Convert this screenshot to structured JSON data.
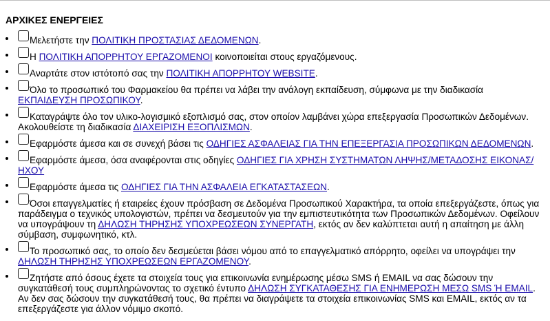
{
  "heading": "ΑΡΧΙΚΕΣ ΕΝΕΡΓΕΙΕΣ",
  "items": [
    {
      "pre": "Μελετήστε την ",
      "link": "ΠΟΛΙΤΙΚΗ ΠΡΟΣΤΑΣΙΑΣ ΔΕΔΟΜΕΝΩΝ",
      "post": "."
    },
    {
      "pre": "Η ",
      "link": "ΠΟΛΙΤΙΚΗ ΑΠΟΡΡΗΤΟΥ ΕΡΓΑΖΟΜΕΝΟΙ",
      "post": " κοινοποιείται στους εργαζόμενους."
    },
    {
      "pre": "Αναρτάτε στον ιστότοπό σας την ",
      "link": "ΠΟΛΙΤΙΚΗ ΑΠΟΡΡΗΤΟΥ WEBSITE",
      "post": "."
    },
    {
      "pre": "Όλο το προσωπικό του Φαρμακείου θα πρέπει να λάβει την ανάλογη εκπαίδευση, σύμφωνα με την διαδικασία ",
      "link": "ΕΚΠΑΙΔΕΥΣΗ ΠΡΟΣΩΠΙΚΟΥ",
      "post": "."
    },
    {
      "pre": "Καταγράψτε όλο τον υλικο-λογισμικό εξοπλισμό σας, στον οποίον λαμβάνει χώρα επεξεργασία Προσωπικών Δεδομένων. Ακολουθείστε τη διαδικασία ",
      "link": "ΔΙΑΧΕΙΡΙΣΗ ΕΞΟΠΛΙΣΜΩΝ",
      "post": "."
    },
    {
      "pre": "Εφαρμόστε άμεσα και σε συνεχή βάσει τις ",
      "link": "ΟΔΗΓΙΕΣ ΑΣΦΑΛΕΙΑΣ ΓΙΑ ΤΗΝ ΕΠΕΞΕΡΓΑΣΙΑ ΠΡΟΣΩΠΙΚΩΝ ΔΕΔΟΜΕΝΩΝ",
      "post": "."
    },
    {
      "pre": "Εφαρμόστε άμεσα, όσα αναφέρονται στις οδηγίες ",
      "link": "ΟΔΗΓΙΕΣ ΓΙΑ ΧΡΗΣΗ ΣΥΣΤΗΜΑΤΩΝ ΛΗΨΗΣ/ΜΕΤΑΔΟΣΗΣ ΕΙΚΟΝΑΣ/ΗΧΟΥ",
      "post": ""
    },
    {
      "pre": "Εφαρμόστε άμεσα τις ",
      "link": "ΟΔΗΓΙΕΣ ΓΙΑ ΤΗΝ ΑΣΦΑΛΕΙΑ ΕΓΚΑΤΑΣΤΑΣΕΩΝ",
      "post": "."
    },
    {
      "pre": "Όσοι επαγγελματίες ή εταιρείες έχουν πρόσβαση σε Δεδομένα Προσωπικού Χαρακτήρα, τα οποία επεξεργάζεστε, όπως για παράδειγμα ο τεχνικός υπολογιστών, πρέπει να δεσμευτούν για την εμπιστευτικότητα των Προσωπικών Δεδομένων. Οφείλουν να υπογράψουν τη ",
      "link": "ΔΗΛΩΣΗ ΤΗΡΗΣΗΣ ΥΠΟΧΡΕΩΣΕΩΝ ΣΥΝΕΡΓΑΤΗ",
      "post": ", εκτός αν δεν καλύπτεται αυτή η απαίτηση με άλλη σύμβαση, συμφωνητικό, κτλ."
    },
    {
      "pre": "Το προσωπικό σας, το οποίο δεν δεσμεύεται βάσει νόμου από το επαγγελματικό απόρρητο, οφείλει να υπογράψει την ",
      "link": "ΔΗΛΩΣΗ ΤΗΡΗΣΗΣ ΥΠΟΧΡΕΩΣΕΩΝ ΕΡΓΑΖΟΜΕΝΟΥ",
      "post": "."
    },
    {
      "pre": "Ζητήστε από όσους έχετε τα στοιχεία τους για επικοινωνία ενημέρωσης μέσω SMS ή EMAIL να σας δώσουν την συγκατάθεσή τους συμπληρώνοντας το σχετικό έντυπο ",
      "link": "ΔΗΛΩΣΗ ΣΥΓΚΑΤΑΘΕΣΗΣ ΓΙΑ ΕΝΗΜΕΡΩΣΗ ΜΕΣΩ SMS Ή EMAIL",
      "post": ". Αν δεν σας δώσουν την συγκατάθεσή τους, θα πρέπει να διαγράψετε τα στοιχεία επικοινωνίας SMS και EMAIL, εκτός αν τα επεξεργάζεστε για άλλον νόμιμο σκοπό."
    }
  ]
}
